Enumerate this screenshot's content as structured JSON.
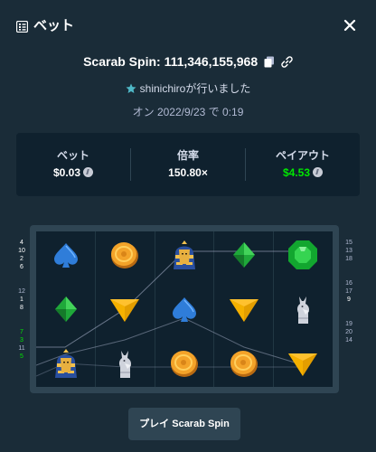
{
  "header": {
    "title": "ベット"
  },
  "spin": {
    "title": "Scarab Spin: 111,346,155,968",
    "player_text": "shinichiroが行いました",
    "date_text": "オン 2022/9/23 で 0:19"
  },
  "stats": {
    "bet_label": "ベット",
    "bet_value": "$0.03",
    "multiplier_label": "倍率",
    "multiplier_value": "150.80×",
    "payout_label": "ペイアウト",
    "payout_value": "$4.53"
  },
  "board": {
    "symbols": [
      [
        "spade",
        "coin",
        "pharaoh",
        "gem-diamond",
        "emerald"
      ],
      [
        "gem-diamond",
        "triangle",
        "spade",
        "triangle",
        "anubis"
      ],
      [
        "pharaoh",
        "anubis",
        "coin",
        "coin",
        "triangle"
      ]
    ],
    "left_lines": [
      {
        "number": "4",
        "color": "#ffffff"
      },
      {
        "number": "10",
        "color": "#ffffff"
      },
      {
        "number": "2",
        "color": "#ffffff"
      },
      {
        "number": "6",
        "color": "#ffffff"
      },
      {
        "number": "12",
        "color": "#b1bad3"
      },
      {
        "number": "1",
        "color": "#ffffff"
      },
      {
        "number": "8",
        "color": "#ffffff"
      },
      {
        "number": "7",
        "color": "#00e701"
      },
      {
        "number": "3",
        "color": "#00e701"
      },
      {
        "number": "11",
        "color": "#b1bad3"
      },
      {
        "number": "5",
        "color": "#00e701"
      }
    ],
    "right_lines": [
      {
        "number": "15",
        "color": "#b1bad3"
      },
      {
        "number": "13",
        "color": "#b1bad3"
      },
      {
        "number": "18",
        "color": "#b1bad3"
      },
      {
        "number": "16",
        "color": "#b1bad3"
      },
      {
        "number": "17",
        "color": "#b1bad3"
      },
      {
        "number": "9",
        "color": "#ffffff"
      },
      {
        "number": "19",
        "color": "#b1bad3"
      },
      {
        "number": "20",
        "color": "#b1bad3"
      },
      {
        "number": "14",
        "color": "#b1bad3"
      }
    ]
  },
  "actions": {
    "play_prefix": "プレイ",
    "play_game": "Scarab Spin"
  },
  "colors": {
    "background": "#1a2c38",
    "panel": "#0f212e",
    "frame": "#2f4553",
    "win_green": "#00e701"
  }
}
